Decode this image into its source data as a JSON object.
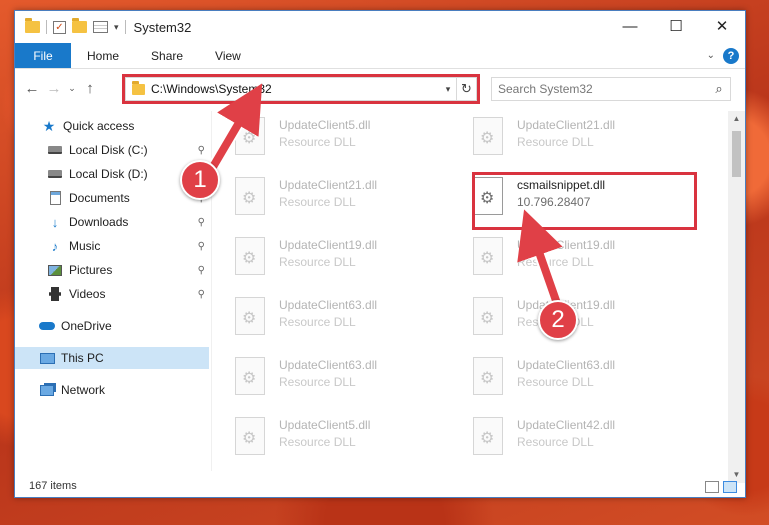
{
  "window": {
    "title": "System32",
    "controls": {
      "minimize": "—",
      "maximize": "☐",
      "close": "✕"
    }
  },
  "ribbon": {
    "file": "File",
    "tabs": [
      "Home",
      "Share",
      "View"
    ],
    "help": "?"
  },
  "nav": {
    "back": "←",
    "forward": "→",
    "recent": "⌄",
    "up": "↑",
    "address": "C:\\Windows\\System32",
    "refresh": "↻",
    "search_placeholder": "Search System32"
  },
  "sidebar": {
    "items": [
      {
        "label": "Quick access",
        "icon": "star-icon",
        "pinned": false
      },
      {
        "label": "Local Disk (C:)",
        "icon": "drive-icon",
        "pinned": true
      },
      {
        "label": "Local Disk (D:)",
        "icon": "drive-icon",
        "pinned": true
      },
      {
        "label": "Documents",
        "icon": "documents-icon",
        "pinned": true
      },
      {
        "label": "Downloads",
        "icon": "downloads-icon",
        "pinned": true
      },
      {
        "label": "Music",
        "icon": "music-icon",
        "pinned": true
      },
      {
        "label": "Pictures",
        "icon": "pictures-icon",
        "pinned": true
      },
      {
        "label": "Videos",
        "icon": "videos-icon",
        "pinned": true
      },
      {
        "label": "OneDrive",
        "icon": "onedrive-icon",
        "pinned": false
      },
      {
        "label": "This PC",
        "icon": "this-pc-icon",
        "pinned": false,
        "selected": true
      },
      {
        "label": "Network",
        "icon": "network-icon",
        "pinned": false
      }
    ],
    "pin_glyph": "📌"
  },
  "files": {
    "left": [
      {
        "name": "UpdateClient5.dll",
        "type": "Resource DLL"
      },
      {
        "name": "UpdateClient21.dll",
        "type": "Resource DLL"
      },
      {
        "name": "UpdateClient19.dll",
        "type": "Resource DLL"
      },
      {
        "name": "UpdateClient63.dll",
        "type": "Resource DLL"
      },
      {
        "name": "UpdateClient63.dll",
        "type": "Resource DLL"
      },
      {
        "name": "UpdateClient5.dll",
        "type": "Resource DLL"
      }
    ],
    "right": [
      {
        "name": "UpdateClient21.dll",
        "type": "Resource DLL"
      },
      {
        "name": "csmailsnippet.dll",
        "type": "10.796.28407",
        "active": true
      },
      {
        "name": "UpdateClient19.dll",
        "type": "Resource DLL"
      },
      {
        "name": "UpdateClient19.dll",
        "type": "Resource DLL"
      },
      {
        "name": "UpdateClient63.dll",
        "type": "Resource DLL"
      },
      {
        "name": "UpdateClient42.dll",
        "type": "Resource DLL"
      }
    ]
  },
  "status": {
    "items": "167 items"
  },
  "callouts": {
    "one": "1",
    "two": "2"
  },
  "colors": {
    "accent": "#1979ca",
    "highlight": "#d9333f",
    "callout": "#e04047"
  }
}
